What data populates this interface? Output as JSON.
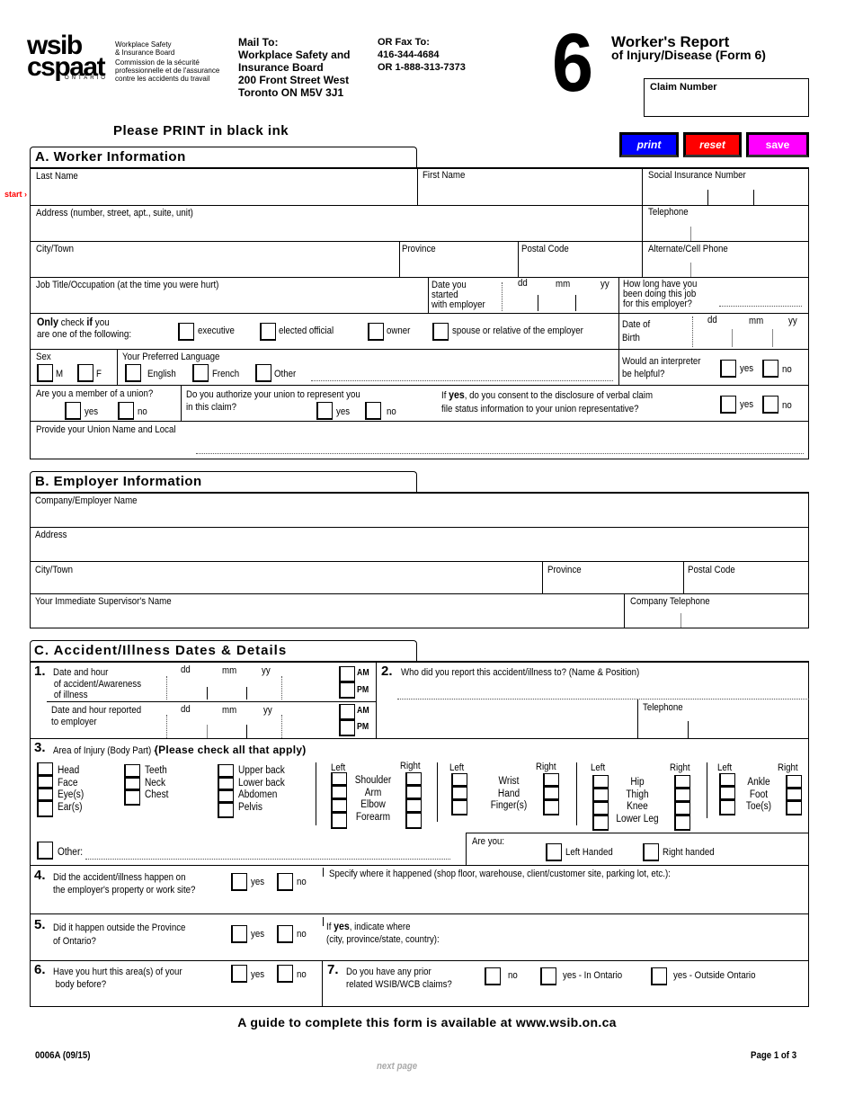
{
  "header": {
    "logo_line1": "wsib",
    "logo_line2": "cspaat",
    "logo_ontario": "ONTARIO",
    "org_en_1": "Workplace Safety",
    "org_en_2": "& Insurance Board",
    "org_fr_1": "Commission de la sécurité",
    "org_fr_2": "professionnelle et de l'assurance",
    "org_fr_3": "contre les accidents du travail",
    "mail_to": [
      "Mail To:",
      "Workplace Safety and",
      "Insurance Board",
      "200 Front Street West",
      "Toronto ON  M5V 3J1"
    ],
    "fax_to": [
      "OR Fax To:",
      "416-344-4684",
      "OR 1-888-313-7373"
    ],
    "form_number": "6",
    "title_line1": "Worker's Report",
    "title_line2": "of Injury/Disease (Form 6)",
    "claim_number_label": "Claim Number",
    "print_instruction": "Please PRINT in black ink"
  },
  "buttons": {
    "print": "print",
    "reset": "reset",
    "save": "save",
    "print_color": "#0000ff",
    "reset_color": "#ff0000",
    "save_color": "#ff00ff"
  },
  "start_marker": "start",
  "sectionA": {
    "title": "A. Worker Information",
    "last_name": "Last Name",
    "first_name": "First Name",
    "sin": "Social Insurance Number",
    "address": "Address (number, street, apt., suite, unit)",
    "telephone": "Telephone",
    "city": "City/Town",
    "province": "Province",
    "postal": "Postal Code",
    "alt_phone": "Alternate/Cell Phone",
    "job_title": "Job Title/Occupation (at the time you were hurt)",
    "date_started_1": "Date you",
    "date_started_2": "started",
    "date_started_3": "with employer",
    "dd": "dd",
    "mm": "mm",
    "yy": "yy",
    "how_long_1": "How long have you",
    "how_long_2": "been doing this job",
    "how_long_3": "for this employer?",
    "only_check_bold1": "Only",
    "only_check_mid": " check ",
    "only_check_bold2": "if",
    "only_check_end": " you",
    "only_check_2": "are one of the following:",
    "roles": [
      "executive",
      "elected official",
      "owner",
      "spouse or relative of the employer"
    ],
    "dob_1": "Date of",
    "dob_2": "Birth",
    "sex": "Sex",
    "sex_m": "M",
    "sex_f": "F",
    "language": "Your Preferred Language",
    "lang_english": "English",
    "lang_french": "French",
    "lang_other": "Other",
    "interpreter_1": "Would an interpreter",
    "interpreter_2": "be helpful?",
    "yes": "yes",
    "no": "no",
    "union_member": "Are you a member of a union?",
    "union_auth_1": "Do you authorize your union to represent you",
    "union_auth_2": "in this claim?",
    "consent_1_pre": "If ",
    "consent_1_bold": "yes",
    "consent_1_post": ", do you consent to the disclosure of verbal claim",
    "consent_2": "file status information to your union representative?",
    "union_name": "Provide your Union Name and Local"
  },
  "sectionB": {
    "title": "B. Employer Information",
    "company": "Company/Employer Name",
    "address": "Address",
    "city": "City/Town",
    "province": "Province",
    "postal": "Postal Code",
    "supervisor": "Your Immediate Supervisor's Name",
    "company_phone": "Company Telephone"
  },
  "sectionC": {
    "title": "C. Accident/Illness Dates & Details",
    "q1_num": "1.",
    "q1_a1": "Date and hour",
    "q1_a2": "of accident/Awareness",
    "q1_a3": "of illness",
    "q1_b1": "Date and hour reported",
    "q1_b2": "to employer",
    "dd": "dd",
    "mm": "mm",
    "yy": "yy",
    "am": "AM",
    "pm": "PM",
    "q2_num": "2.",
    "q2_text": "Who did you report this accident/illness to? (Name & Position)",
    "telephone": "Telephone",
    "q3_num": "3.",
    "q3_text": "Area of Injury (Body Part) - ",
    "q3_bold": "(Please check all that apply)",
    "col1": [
      "Head",
      "Face",
      "Eye(s)",
      "Ear(s)"
    ],
    "col2": [
      "Teeth",
      "Neck",
      "Chest"
    ],
    "col3": [
      "Upper back",
      "Lower back",
      "Abdomen",
      "Pelvis"
    ],
    "left": "Left",
    "right": "Right",
    "arm_parts": [
      "Shoulder",
      "Arm",
      "Elbow",
      "Forearm"
    ],
    "hand_parts": [
      "Wrist",
      "Hand",
      "Finger(s)"
    ],
    "leg_parts": [
      "Hip",
      "Thigh",
      "Knee",
      "Lower Leg"
    ],
    "foot_parts": [
      "Ankle",
      "Foot",
      "Toe(s)"
    ],
    "other": "Other:",
    "are_you": "Are you:",
    "left_handed": "Left Handed",
    "right_handed": "Right handed",
    "q4_num": "4.",
    "q4_1": "Did the accident/illness happen on",
    "q4_2": "the  employer's property or work site?",
    "q4_specify": "Specify where it happened (shop floor, warehouse, client/customer site, parking lot, etc.):",
    "q5_num": "5.",
    "q5_1": "Did it happen outside the Province",
    "q5_2": "of Ontario?",
    "q5_if_pre": "If ",
    "q5_if_bold": "yes",
    "q5_if_post": ", indicate where",
    "q5_if_2": "(city, province/state, country):",
    "q6_num": "6.",
    "q6_1": "Have you hurt this area(s) of your",
    "q6_2": "body before?",
    "q7_num": "7.",
    "q7_1": "Do you have any prior",
    "q7_2": "related  WSIB/WCB claims?",
    "q7_no": "no",
    "q7_yes_on": "yes - In Ontario",
    "q7_yes_out": "yes - Outside Ontario",
    "yes": "yes",
    "no": "no"
  },
  "footer": {
    "guide": "A guide to complete this form is available at www.wsib.on.ca",
    "form_code": "0006A (09/15)",
    "page": "Page 1 of 3",
    "next_page": "next page"
  }
}
